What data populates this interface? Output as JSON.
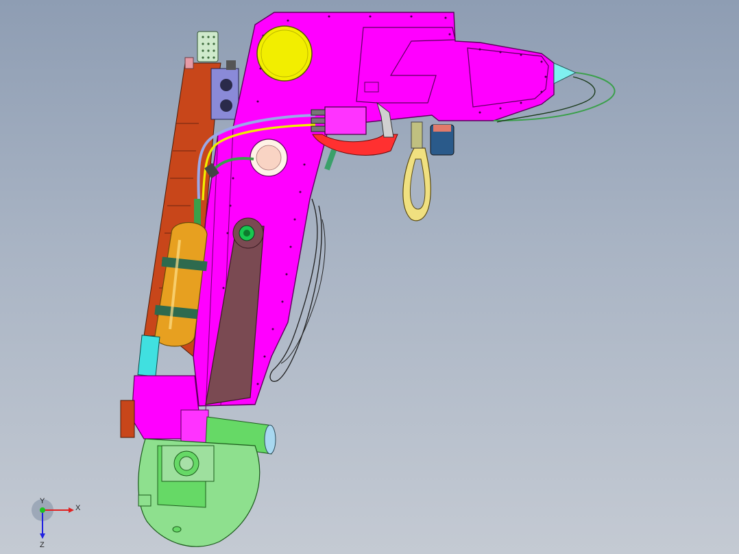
{
  "viewport": {
    "background_top": "#8e9db3",
    "background_bottom": "#c4cad3"
  },
  "colors": {
    "arm_body": "#ff00ff",
    "arm_outline": "#5a005a",
    "rail": "#c8461a",
    "cylinder": "#e7a020",
    "belt": "#7a4a52",
    "base": "#8ee08e",
    "gear_cover": "#66d966",
    "pulley": "#f2ee00",
    "cable_green": "#3aa04a",
    "cable_yellow": "#f0f000",
    "cable_blue": "#9aa8e8",
    "handle": "#f0e080",
    "sensor_tip": "#7ff0f0"
  },
  "triad": {
    "x_label": "X",
    "y_label": "Y",
    "z_label": "Z"
  }
}
